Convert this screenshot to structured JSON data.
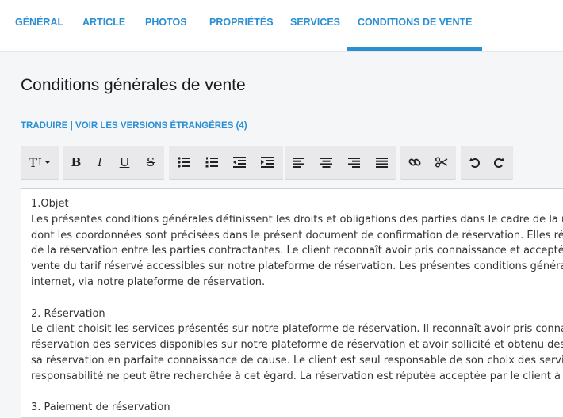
{
  "tabs": [
    {
      "label": "GÉNÉRAL"
    },
    {
      "label": "ARTICLE"
    },
    {
      "label": "PHOTOS"
    },
    {
      "label": "PROPRIÉTÉS"
    },
    {
      "label": "SERVICES"
    },
    {
      "label": "CONDITIONS DE VENTE",
      "active": true
    }
  ],
  "page": {
    "title": "Conditions générales de vente"
  },
  "links": {
    "translate": "TRADUIRE",
    "separator": " | ",
    "foreign_versions": "VOIR LES VERSIONS ÉTRANGÈRES (4)"
  },
  "toolbar": {
    "icons": [
      "text-style-icon",
      "bold-icon",
      "italic-icon",
      "underline-icon",
      "strikethrough-icon",
      "bullet-list-icon",
      "numbered-list-icon",
      "outdent-icon",
      "indent-icon",
      "align-left-icon",
      "align-center-icon",
      "align-right-icon",
      "justify-icon",
      "link-icon",
      "unlink-icon",
      "undo-icon",
      "redo-icon"
    ],
    "text_style": "T",
    "bold": "B",
    "italic": "I",
    "underline": "U",
    "strikethrough": "S"
  },
  "editor": {
    "lines": [
      "1.Objet",
      "Les présentes conditions générales définissent les droits et obligations des parties dans le cadre de la re",
      "dont les coordonnées sont précisées dans le présent document de confirmation de réservation. Elles ré",
      "de la réservation entre les parties contractantes. Le client reconnaît avoir pris connaissance et accepté l",
      "vente du tarif réservé accessibles sur notre plateforme de réservation. Les présentes conditions généra",
      "internet, via notre plateforme de réservation.",
      "",
      "2. Réservation",
      "Le client choisit les services présentés sur notre plateforme de réservation. Il reconnaît avoir pris conna",
      "réservation des services disponibles sur notre plateforme de réservation et avoir sollicité et obtenu des",
      "sa réservation en parfaite connaissance de cause. Le client est seul responsable de son choix des servic",
      "responsabilité ne peut être recherchée à cet égard. La réservation est réputée acceptée par le client à l'i",
      "",
      "3. Paiement de réservation"
    ]
  },
  "colors": {
    "accent": "#2b8fd4",
    "toolbar_bg": "#e9e9eb",
    "page_bg": "#f5f6f8",
    "text": "#333333"
  }
}
